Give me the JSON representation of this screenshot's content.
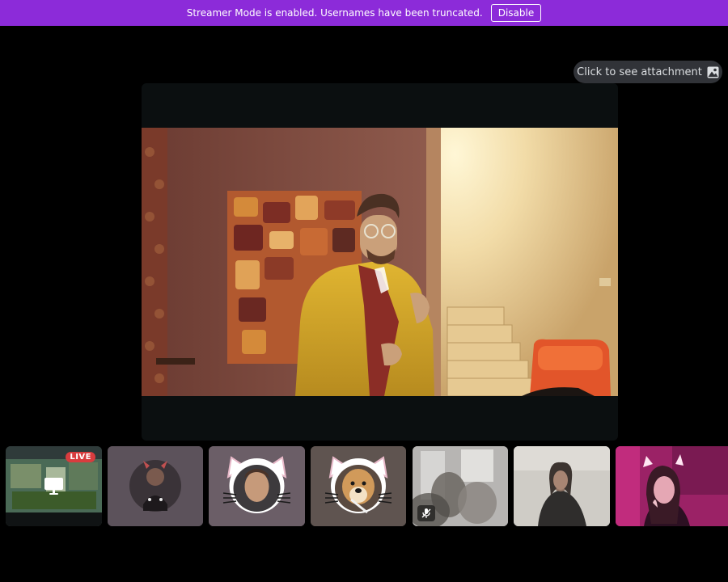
{
  "banner": {
    "message": "Streamer Mode is enabled. Usernames have been truncated.",
    "button_label": "Disable",
    "color": "#8c2bd9"
  },
  "attachment": {
    "label": "Click to see attachment",
    "icon": "image-icon"
  },
  "stage": {
    "background": "#0b0f10"
  },
  "tiles": [
    {
      "kind": "screen-share",
      "badge": "LIVE",
      "icon": "monitor-icon"
    },
    {
      "kind": "avatar-video"
    },
    {
      "kind": "avatar-cat-filter"
    },
    {
      "kind": "avatar-dog-filter"
    },
    {
      "kind": "camera-blurred",
      "icon": "mic-off-icon"
    },
    {
      "kind": "camera"
    },
    {
      "kind": "camera-cat-ears"
    }
  ]
}
